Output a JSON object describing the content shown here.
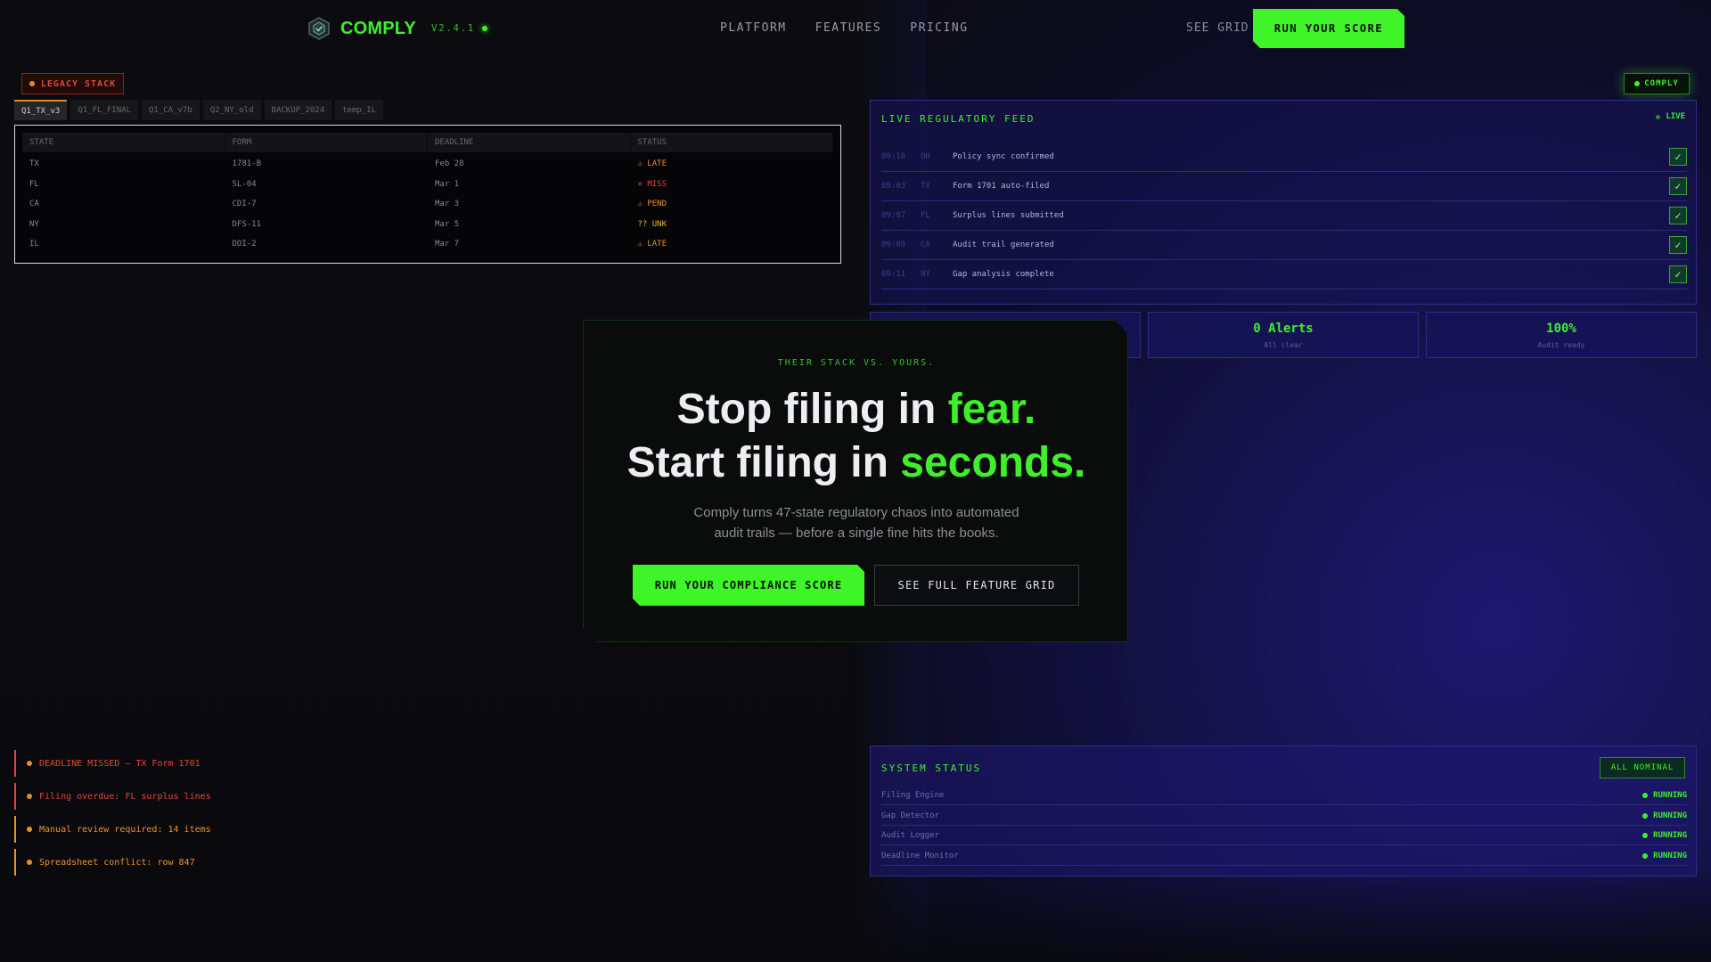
{
  "nav": {
    "brand": "COMPLY",
    "version": "V2.4.1",
    "links": [
      "PLATFORM",
      "FEATURES",
      "PRICING"
    ],
    "see_grid": "SEE GRID",
    "cta": "RUN YOUR SCORE"
  },
  "legacy": {
    "badge": "LEGACY STACK",
    "tabs": [
      "Q1_TX_v3",
      "Q1_FL_FINAL",
      "Q1_CA_v7b",
      "Q2_NY_old",
      "BACKUP_2024",
      "temp_IL"
    ],
    "active_tab": "Q1_TX_v3",
    "columns": [
      "STATE",
      "FORM",
      "DEADLINE",
      "STATUS"
    ],
    "rows": [
      {
        "state": "TX",
        "form": "1781-B",
        "deadline": "Feb 28",
        "status": "⚠ LATE"
      },
      {
        "state": "FL",
        "form": "SL-04",
        "deadline": "Mar 1",
        "status": "✕ MISS"
      },
      {
        "state": "CA",
        "form": "CDI-7",
        "deadline": "Mar 3",
        "status": "⚠ PEND"
      },
      {
        "state": "NY",
        "form": "DFS-11",
        "deadline": "Mar 5",
        "status": "?? UNK"
      },
      {
        "state": "IL",
        "form": "DOI-2",
        "deadline": "Mar 7",
        "status": "⚠ LATE"
      }
    ],
    "alerts": [
      "DEADLINE MISSED — TX Form 1701",
      "Filing overdue: FL surplus lines",
      "Manual review required: 14 items",
      "Spreadsheet conflict: row 847"
    ]
  },
  "comply_badge": "COMPLY",
  "feed": {
    "title": "LIVE REGULATORY FEED",
    "live": "LIVE",
    "items": [
      {
        "time": "09:18",
        "code": "OH",
        "msg": "Policy sync confirmed"
      },
      {
        "time": "09:03",
        "code": "TX",
        "msg": "Form 1701 auto-filed"
      },
      {
        "time": "09:07",
        "code": "FL",
        "msg": "Surplus lines submitted"
      },
      {
        "time": "09:09",
        "code": "CA",
        "msg": "Audit trail generated"
      },
      {
        "time": "09:11",
        "code": "NY",
        "msg": "Gap analysis complete"
      }
    ],
    "check": "✓"
  },
  "stats": [
    {
      "value": "",
      "label": ""
    },
    {
      "value": "0 Alerts",
      "label": "All clear"
    },
    {
      "value": "100%",
      "label": "Audit ready"
    }
  ],
  "system": {
    "title": "SYSTEM STATUS",
    "badge": "ALL NOMINAL",
    "rows": [
      {
        "name": "Filing Engine",
        "state": "RUNNING"
      },
      {
        "name": "Gap Detector",
        "state": "RUNNING"
      },
      {
        "name": "Audit Logger",
        "state": "RUNNING"
      },
      {
        "name": "Deadline Monitor",
        "state": "RUNNING"
      }
    ]
  },
  "hero": {
    "kicker": "THEIR STACK VS. YOURS.",
    "line1_a": "Stop filing in ",
    "line1_b": "fear.",
    "line2_a": "Start filing in ",
    "line2_b": "seconds.",
    "sub": "Comply turns 47-state regulatory chaos into automated audit trails — before a single fine hits the books.",
    "primary_cta": "RUN YOUR COMPLIANCE SCORE",
    "secondary_cta": "SEE FULL FEATURE GRID"
  },
  "colors": {
    "accent": "#3ef02a",
    "danger": "#e0473a",
    "warning": "#e8922f",
    "panel": "#16145a"
  }
}
